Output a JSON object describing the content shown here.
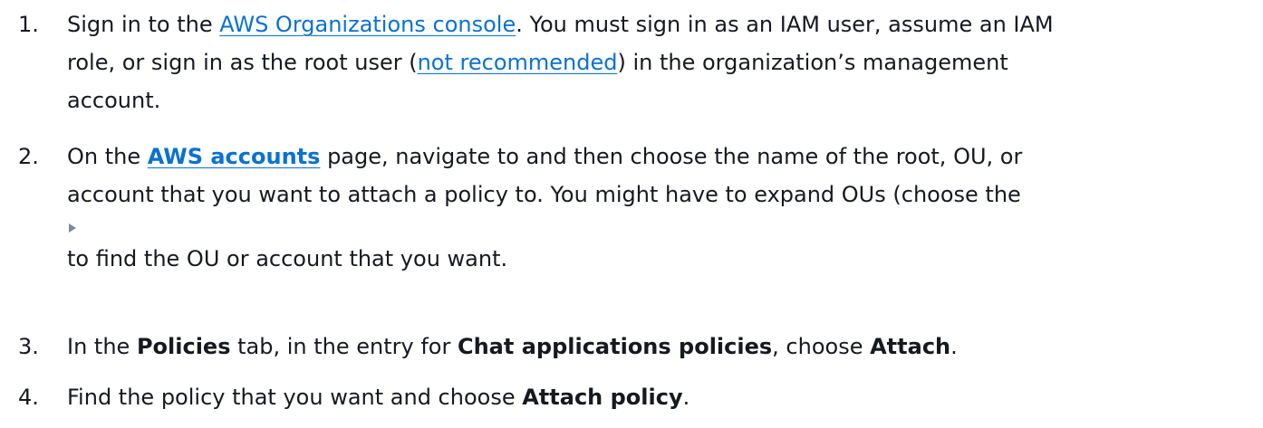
{
  "steps": [
    {
      "number": "1.",
      "lines": [
        {
          "parts": [
            {
              "text": "Sign in to the ",
              "style": "text"
            },
            {
              "text": "AWS Organizations console",
              "style": "link"
            },
            {
              "text": ". You must sign in as an IAM user, assume an IAM",
              "style": "text"
            }
          ]
        },
        {
          "parts": [
            {
              "text": "role, or sign in as the root user (",
              "style": "text"
            },
            {
              "text": "not recommended",
              "style": "link"
            },
            {
              "text": ") in the organization’s management",
              "style": "text"
            }
          ]
        },
        {
          "parts": [
            {
              "text": "account.",
              "style": "text"
            }
          ]
        }
      ]
    },
    {
      "number": "2.",
      "lines": [
        {
          "parts": [
            {
              "text": "On the ",
              "style": "text"
            },
            {
              "text": "AWS accounts",
              "style": "boldlink"
            },
            {
              "text": " page, navigate to and then choose the name of the root, OU, or",
              "style": "text"
            }
          ]
        },
        {
          "parts": [
            {
              "text": "account that you want to attach a policy to. You might have to expand OUs (choose the",
              "style": "text"
            }
          ]
        },
        {
          "icon": "expand-triangle-icon"
        },
        {
          "parts": [
            {
              "text": "to find the OU or account that you want.",
              "style": "text"
            }
          ]
        }
      ]
    },
    {
      "number": "3.",
      "lines": [
        {
          "parts": [
            {
              "text": "In the ",
              "style": "text"
            },
            {
              "text": "Policies",
              "style": "bold"
            },
            {
              "text": " tab, in the entry for ",
              "style": "text"
            },
            {
              "text": "Chat applications policies",
              "style": "bold"
            },
            {
              "text": ", choose ",
              "style": "text"
            },
            {
              "text": "Attach",
              "style": "bold"
            },
            {
              "text": ".",
              "style": "text"
            }
          ]
        }
      ]
    },
    {
      "number": "4.",
      "lines": [
        {
          "parts": [
            {
              "text": "Find the policy that you want and choose ",
              "style": "text"
            },
            {
              "text": "Attach policy",
              "style": "bold"
            },
            {
              "text": ".",
              "style": "text"
            }
          ]
        }
      ]
    }
  ]
}
